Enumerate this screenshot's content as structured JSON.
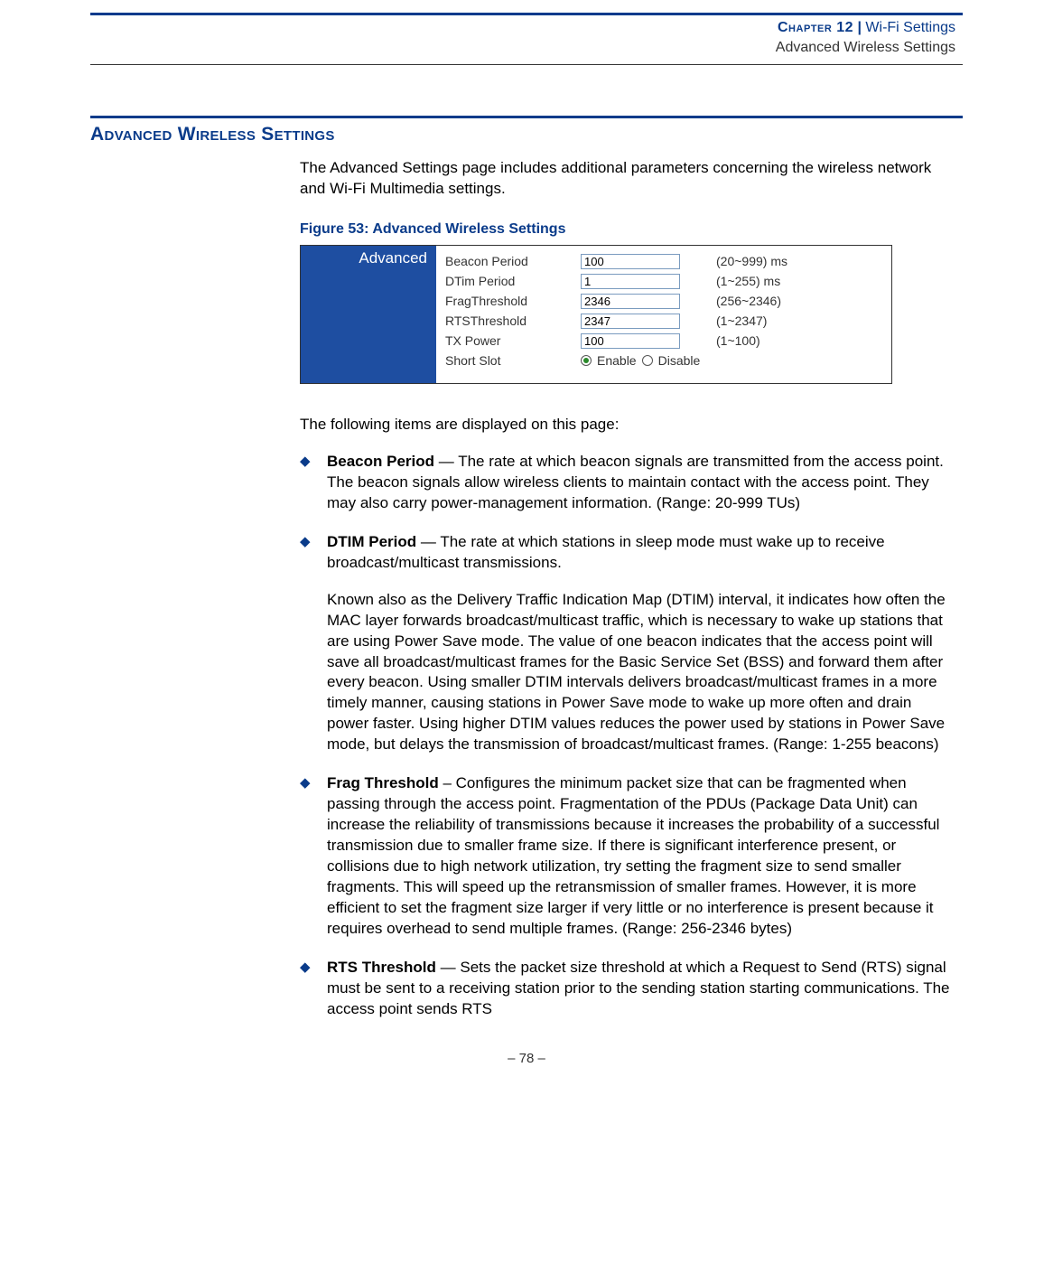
{
  "header": {
    "chapter_label": "Chapter 12",
    "separator": "|",
    "chapter_title": "Wi-Fi Settings",
    "subtitle": "Advanced Wireless Settings"
  },
  "section": {
    "heading": "Advanced Wireless Settings",
    "intro": "The Advanced Settings page includes additional parameters concerning the wireless network and Wi-Fi Multimedia settings.",
    "figure_label": "Figure 53:  Advanced Wireless Settings"
  },
  "figure": {
    "side_tab": "Advanced",
    "rows": [
      {
        "label": "Beacon Period",
        "value": "100",
        "range": "(20~999) ms"
      },
      {
        "label": "DTim Period",
        "value": "1",
        "range": "(1~255) ms"
      },
      {
        "label": "FragThreshold",
        "value": "2346",
        "range": "(256~2346)"
      },
      {
        "label": "RTSThreshold",
        "value": "2347",
        "range": "(1~2347)"
      },
      {
        "label": "TX Power",
        "value": "100",
        "range": "(1~100)"
      }
    ],
    "short_slot": {
      "label": "Short Slot",
      "enable": "Enable",
      "disable": "Disable"
    }
  },
  "body": {
    "lead": "The following items are displayed on this page:"
  },
  "items": [
    {
      "title": "Beacon Period",
      "sep": " — ",
      "text": "The rate at which beacon signals are transmitted from the access point. The beacon signals allow wireless clients to maintain contact with the access point. They may also carry power-management information. (Range: 20-999 TUs)"
    },
    {
      "title": "DTIM Period",
      "sep": " — ",
      "text": "The rate at which stations in sleep mode must wake up to receive broadcast/multicast transmissions.",
      "extra": "Known also as the Delivery Traffic Indication Map (DTIM) interval, it indicates how often the MAC layer forwards broadcast/multicast traffic, which is necessary to wake up stations that are using Power Save mode. The value of one beacon indicates that the access point will save all broadcast/multicast frames for the Basic Service Set (BSS) and forward them after every beacon. Using smaller DTIM intervals delivers broadcast/multicast frames in a more timely manner, causing stations in Power Save mode to wake up more often and drain power faster. Using higher DTIM values reduces the power used by stations in Power Save mode, but delays the transmission of broadcast/multicast frames. (Range: 1-255 beacons)"
    },
    {
      "title": "Frag Threshold",
      "sep": " – ",
      "text": "Configures the minimum packet size that can be fragmented when passing through the access point. Fragmentation of the PDUs (Package Data Unit) can increase the reliability of transmissions because it increases the probability of a successful transmission due to smaller frame size. If there is significant interference present, or collisions due to high network utilization, try setting the fragment size to send smaller fragments. This will speed up the retransmission of smaller frames. However, it is more efficient to set the fragment size larger if very little or no interference is present because it requires overhead to send multiple frames. (Range: 256-2346 bytes)"
    },
    {
      "title": "RTS Threshold",
      "sep": " — ",
      "text": "Sets the packet size threshold at which a Request to Send (RTS) signal must be sent to a receiving station prior to the sending station starting communications. The access point sends RTS"
    }
  ],
  "footer": {
    "page": "–  78  –"
  }
}
